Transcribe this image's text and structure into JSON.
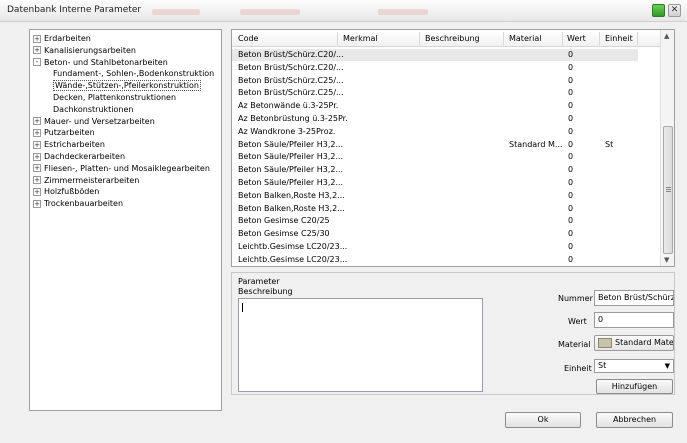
{
  "window": {
    "title": "Datenbank Interne Parameter"
  },
  "tree": [
    {
      "label": "Erdarbeiten",
      "level": 0,
      "expander": "+"
    },
    {
      "label": "Kanalisierungsarbeiten",
      "level": 0,
      "expander": "+"
    },
    {
      "label": "Beton- und Stahlbetonarbeiten",
      "level": 0,
      "expander": "-"
    },
    {
      "label": "Fundament-, Sohlen-,Bodenkonstruktion",
      "level": 1,
      "expander": ""
    },
    {
      "label": "Wände-,Stützen-,Pfeilerkonstruktion",
      "level": 1,
      "expander": "",
      "selected": true
    },
    {
      "label": "Decken, Plattenkonstruktionen",
      "level": 1,
      "expander": ""
    },
    {
      "label": "Dachkonstruktionen",
      "level": 1,
      "expander": ""
    },
    {
      "label": "Mauer- und Versetzarbeiten",
      "level": 0,
      "expander": "+"
    },
    {
      "label": "Putzarbeiten",
      "level": 0,
      "expander": "+"
    },
    {
      "label": "Estricharbeiten",
      "level": 0,
      "expander": "+"
    },
    {
      "label": "Dachdeckerarbeiten",
      "level": 0,
      "expander": "+"
    },
    {
      "label": "Fliesen-, Platten- und Mosaiklegearbeiten",
      "level": 0,
      "expander": "+"
    },
    {
      "label": "Zimmermeisterarbeiten",
      "level": 0,
      "expander": "+"
    },
    {
      "label": "Holzfußböden",
      "level": 0,
      "expander": "+"
    },
    {
      "label": "Trockenbauarbeiten",
      "level": 0,
      "expander": "+"
    }
  ],
  "table": {
    "headers": [
      "Code",
      "Merkmal",
      "Beschreibung",
      "Material",
      "Wert",
      "Einheit"
    ],
    "rows": [
      [
        "Beton Brüst/Schürz.C20/...",
        "",
        "",
        "",
        "0",
        ""
      ],
      [
        "Beton Brüst/Schürz.C20/...",
        "",
        "",
        "",
        "0",
        ""
      ],
      [
        "Beton Brüst/Schürz.C25/...",
        "",
        "",
        "",
        "0",
        ""
      ],
      [
        "Beton Brüst/Schürz.C25/...",
        "",
        "",
        "",
        "0",
        ""
      ],
      [
        "Az Betonwände ü.3-25Pr.",
        "",
        "",
        "",
        "0",
        ""
      ],
      [
        "Az Betonbrüstung ü.3-25Pr.",
        "",
        "",
        "",
        "0",
        ""
      ],
      [
        "Az Wandkrone 3-25Proz.",
        "",
        "",
        "",
        "0",
        ""
      ],
      [
        "Beton Säule/Pfeiler H3,2...",
        "",
        "",
        "Standard M...",
        "0",
        "St"
      ],
      [
        "Beton Säule/Pfeiler H3,2...",
        "",
        "",
        "",
        "0",
        ""
      ],
      [
        "Beton Säule/Pfeiler H3,2...",
        "",
        "",
        "",
        "0",
        ""
      ],
      [
        "Beton Säule/Pfeiler H3,2...",
        "",
        "",
        "",
        "0",
        ""
      ],
      [
        "Beton Balken,Roste H3,2...",
        "",
        "",
        "",
        "0",
        ""
      ],
      [
        "Beton Balken,Roste H3,2...",
        "",
        "",
        "",
        "0",
        ""
      ],
      [
        "Beton Gesimse C20/25",
        "",
        "",
        "",
        "0",
        ""
      ],
      [
        "Beton Gesimse C25/30",
        "",
        "",
        "",
        "0",
        ""
      ],
      [
        "Leichtb.Gesimse LC20/23...",
        "",
        "",
        "",
        "0",
        ""
      ],
      [
        "Leichtb.Gesimse LC20/23...",
        "",
        "",
        "",
        "0",
        ""
      ]
    ],
    "selected_row": 0
  },
  "form": {
    "group_label": "Parameter",
    "beschreibung_label": "Beschreibung",
    "beschreibung_value": "",
    "nummer_label": "Nummer",
    "nummer_value": "Beton Brüst/Schürz.C",
    "wert_label": "Wert",
    "wert_value": "0",
    "material_label": "Material",
    "material_value": "Standard Materi",
    "material_color": "#c8c4aa",
    "einheit_label": "Einheit",
    "einheit_value": "St",
    "add_button": "Hinzufügen"
  },
  "buttons": {
    "ok": "Ok",
    "cancel": "Abbrechen"
  },
  "icons": {
    "scroll_up": "▲",
    "scroll_down": "▼",
    "dropdown": "▼",
    "close": "✕"
  }
}
